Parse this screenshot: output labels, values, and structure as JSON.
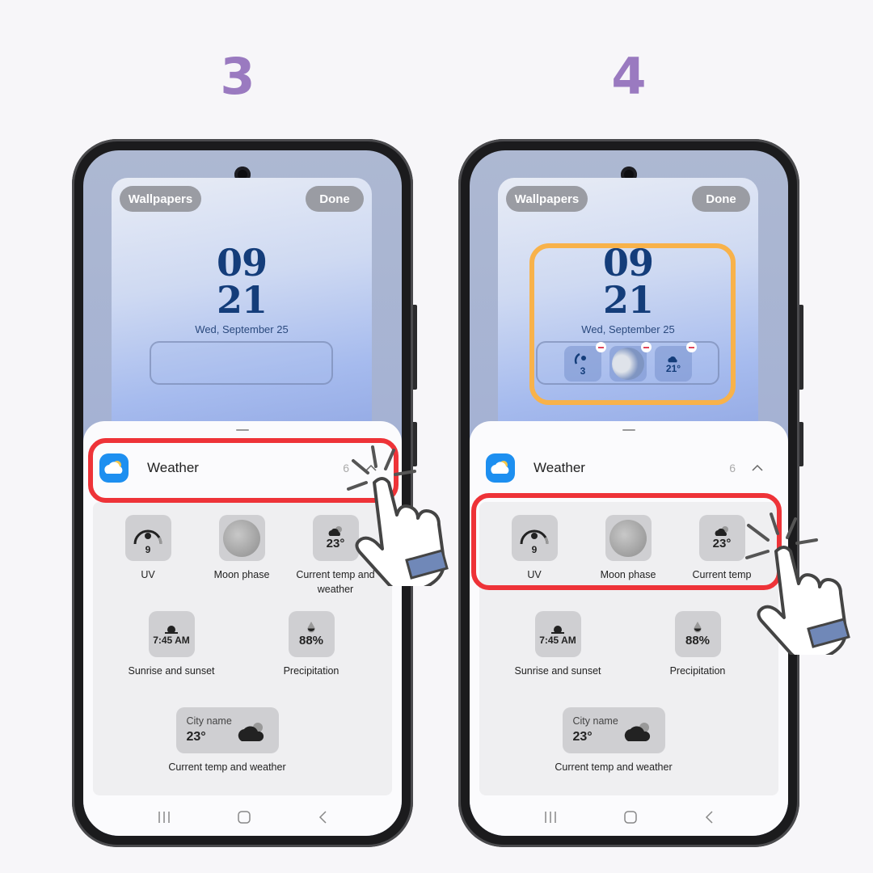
{
  "steps": [
    {
      "number": "3",
      "lockscreen": {
        "wallpapers_button": "Wallpapers",
        "done_button": "Done",
        "clock_hour": "09",
        "clock_minute": "21",
        "date": "Wed, September 25",
        "widget_slot": "empty"
      },
      "sheet": {
        "app_name": "Weather",
        "widget_count": "6",
        "expand_icon": "chevron-up-icon",
        "highlight": "app-row",
        "widgets": [
          {
            "label": "UV",
            "value": "9",
            "icon": "uv-gauge-icon"
          },
          {
            "label": "Moon phase",
            "value": "",
            "icon": "moon-icon"
          },
          {
            "label": "Current temp and weather",
            "value": "23°",
            "icon": "cloud-icon"
          },
          {
            "label": "Sunrise and sunset",
            "value": "7:45 AM",
            "icon": "sunrise-icon"
          },
          {
            "label": "Precipitation",
            "value": "88%",
            "icon": "raindrop-icon"
          },
          {
            "label": "Current temp and weather",
            "city": "City name",
            "value": "23°",
            "icon": "cloud-icon"
          }
        ]
      },
      "nav": [
        "recents-icon",
        "home-icon",
        "back-icon"
      ]
    },
    {
      "number": "4",
      "lockscreen": {
        "wallpapers_button": "Wallpapers",
        "done_button": "Done",
        "clock_hour": "09",
        "clock_minute": "21",
        "date": "Wed, September 25",
        "added_widgets": [
          {
            "name": "UV",
            "value": "3"
          },
          {
            "name": "Moon phase",
            "value": ""
          },
          {
            "name": "Current temp",
            "value": "21°"
          }
        ]
      },
      "sheet": {
        "app_name": "Weather",
        "widget_count": "6",
        "expand_icon": "chevron-up-icon",
        "highlight": "first-widget-row",
        "widgets": [
          {
            "label": "UV",
            "value": "9"
          },
          {
            "label": "Moon phase",
            "value": ""
          },
          {
            "label": "Current temp",
            "value": "23°"
          },
          {
            "label": "Sunrise and sunset",
            "value": "7:45 AM"
          },
          {
            "label": "Precipitation",
            "value": "88%"
          },
          {
            "label": "Current temp and weather",
            "city": "City name",
            "value": "23°"
          }
        ]
      }
    }
  ],
  "colors": {
    "step_number": "#9a7ac0",
    "highlight_red": "#ee3338",
    "highlight_orange": "#f8b24a",
    "weather_icon_blue": "#1d8ff0",
    "clock_blue": "#143d7a"
  }
}
